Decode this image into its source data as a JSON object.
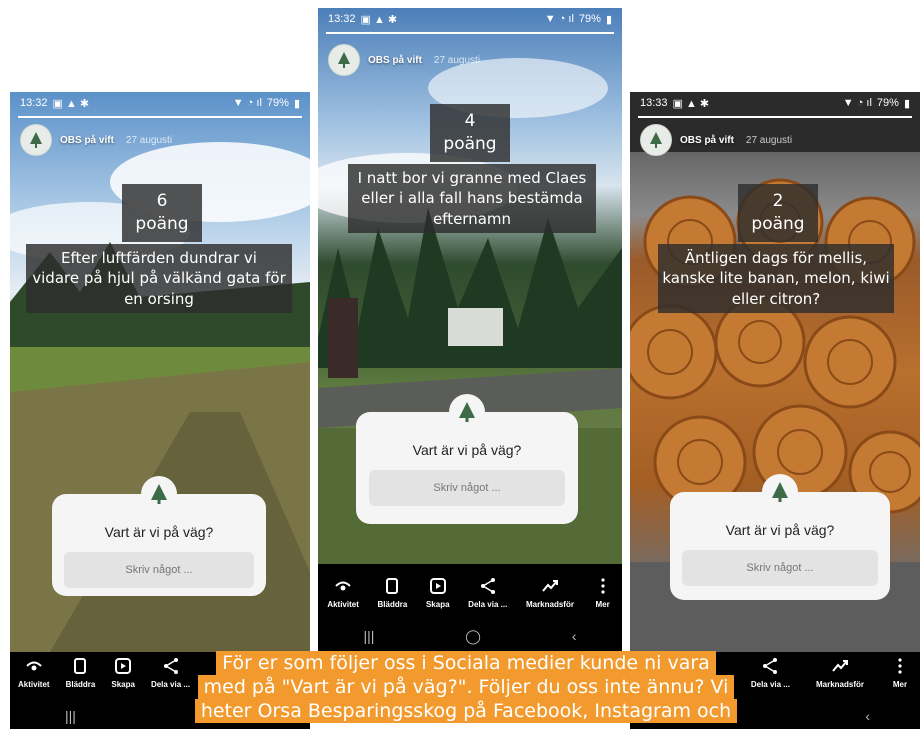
{
  "screens": [
    {
      "id": "left",
      "status": {
        "time": "13:32",
        "battery": "79%"
      },
      "user": {
        "name": "OBS på vift",
        "date": "27 augusti"
      },
      "points": "6 poäng",
      "clue": [
        "Efter luftfärden dundrar vi",
        "vidare på hjul på välkänd gata för",
        "en orsing"
      ],
      "question": {
        "title": "Vart är vi på väg?",
        "placeholder": "Skriv något ..."
      },
      "actions": [
        "Aktivitet",
        "Bläddra",
        "Skapa",
        "Dela via ..."
      ]
    },
    {
      "id": "middle",
      "status": {
        "time": "13:32",
        "battery": "79%"
      },
      "user": {
        "name": "OBS på vift",
        "date": "27 augusti"
      },
      "points": "4 poäng",
      "clue": [
        "I natt bor vi granne med Claes",
        "eller i alla fall hans bestämda",
        "efternamn"
      ],
      "question": {
        "title": "Vart är vi på väg?",
        "placeholder": "Skriv något ..."
      },
      "actions": [
        "Aktivitet",
        "Bläddra",
        "Skapa",
        "Dela via ...",
        "Marknadsför",
        "Mer"
      ]
    },
    {
      "id": "right",
      "status": {
        "time": "13:33",
        "battery": "79%"
      },
      "user": {
        "name": "OBS på vift",
        "date": "27 augusti"
      },
      "points": "2 poäng",
      "clue": [
        "Äntligen dags för mellis,",
        "kanske lite banan, melon, kiwi",
        "eller citron?"
      ],
      "question": {
        "title": "Vart är vi på väg?",
        "placeholder": "Skriv något ..."
      },
      "actions": [
        "Dela via ...",
        "Marknadsför",
        "Mer"
      ]
    }
  ],
  "caption": [
    "För er som följer oss i Sociala medier kunde ni vara",
    "med på \"Vart är vi på väg?\". Följer du oss inte ännu? Vi",
    "heter Orsa Besparingsskog på Facebook, Instagram och"
  ],
  "colors": {
    "caption_bg": "#f29a2e",
    "overlay": "#2d2d2d"
  }
}
